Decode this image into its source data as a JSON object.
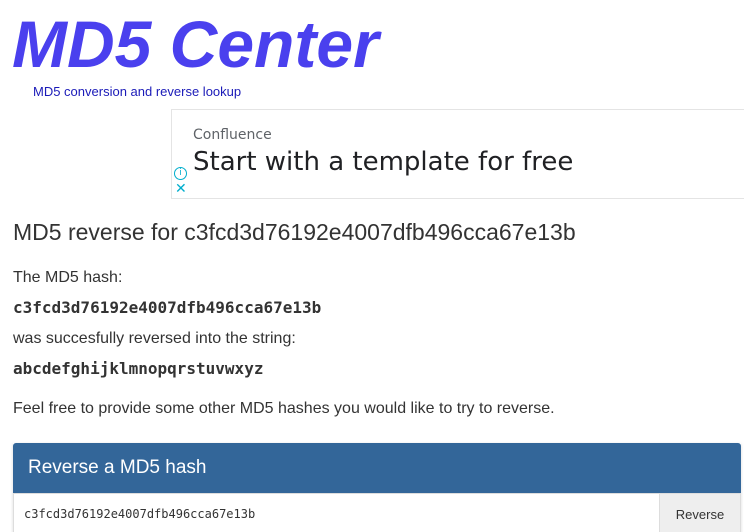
{
  "logo": {
    "title": "MD5 Center",
    "tagline": "MD5 conversion and reverse lookup"
  },
  "ad": {
    "brand": "Confluence",
    "headline": "Start with a template for free",
    "info_icon": "info-icon",
    "close_icon": "close-icon"
  },
  "result": {
    "heading": "MD5 reverse for c3fcd3d76192e4007dfb496cca67e13b",
    "intro": "The MD5 hash:",
    "hash": "c3fcd3d76192e4007dfb496cca67e13b",
    "reversed_text": "was succesfully reversed into the string:",
    "string": "abcdefghijklmnopqrstuvwxyz",
    "invite": "Feel free to provide some other MD5 hashes you would like to try to reverse."
  },
  "reverse_panel": {
    "title": "Reverse a MD5 hash",
    "input_value": "c3fcd3d76192e4007dfb496cca67e13b",
    "button_label": "Reverse"
  },
  "colors": {
    "logo": "#4a40ee",
    "tagline": "#1a1ab8",
    "panel_header": "#336699"
  }
}
